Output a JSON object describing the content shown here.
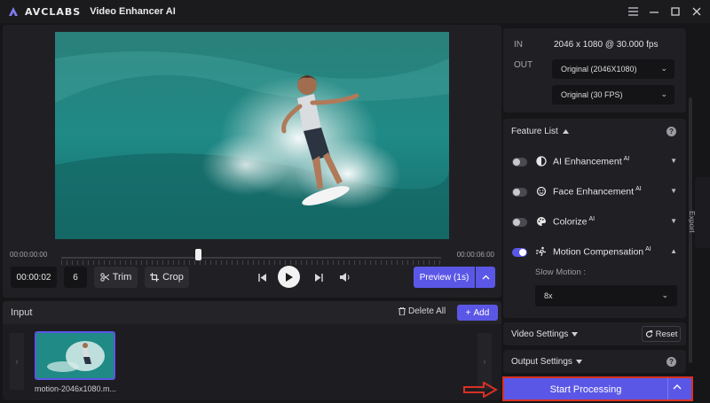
{
  "app": {
    "brand": "AVCLABS",
    "title": "Video Enhancer AI"
  },
  "window_controls": [
    "menu-icon",
    "minimize-icon",
    "maximize-icon",
    "close-icon"
  ],
  "player": {
    "time_start": "00:00:00:00",
    "time_end": "00:00:06:00",
    "playhead_fraction": 0.36,
    "current_time": "00:00:02",
    "frame": "6",
    "trim_label": "Trim",
    "crop_label": "Crop",
    "preview_label": "Preview (1s)"
  },
  "input": {
    "title": "Input",
    "delete_all_label": "Delete All",
    "add_label": "Add",
    "files": [
      {
        "name": "motion-2046x1080.m..."
      }
    ]
  },
  "io": {
    "in_label": "IN",
    "in_value": "2046 x 1080 @ 30.000 fps",
    "out_label": "OUT",
    "resolution_select": "Original (2046X1080)",
    "fps_select": "Original (30 FPS)"
  },
  "features": {
    "title": "Feature List",
    "items": [
      {
        "label": "AI Enhancement",
        "badge": "AI",
        "enabled": false,
        "icon": "contrast-icon"
      },
      {
        "label": "Face Enhancement",
        "badge": "AI",
        "enabled": false,
        "icon": "face-icon"
      },
      {
        "label": "Colorize",
        "badge": "AI",
        "enabled": false,
        "icon": "palette-icon"
      },
      {
        "label": "Motion Compensation",
        "badge": "AI",
        "enabled": true,
        "icon": "motion-icon"
      }
    ],
    "slow_motion_label": "Slow Motion :",
    "slow_motion_value": "8x"
  },
  "video_settings": {
    "title": "Video Settings",
    "reset_label": "Reset"
  },
  "output_settings": {
    "title": "Output Settings"
  },
  "export_label": "Export",
  "start_label": "Start Processing",
  "colors": {
    "accent": "#5b57e6",
    "highlight": "#d93025",
    "bg": "#161618"
  }
}
